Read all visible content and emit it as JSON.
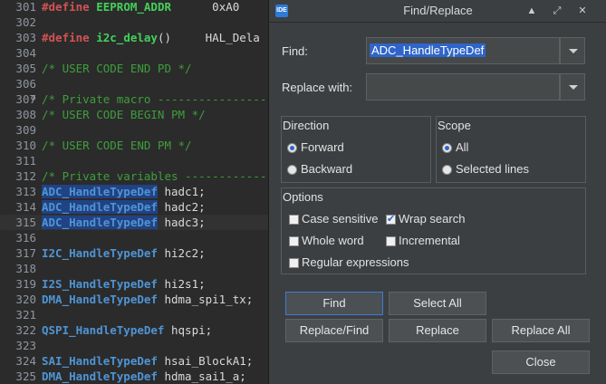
{
  "editor": {
    "lines": [
      {
        "num": "301",
        "parts": [
          {
            "c": "pp",
            "t": "#define "
          },
          {
            "c": "mac",
            "t": "EEPROM_ADDR"
          },
          {
            "c": "kw",
            "t": "      0xA0"
          }
        ]
      },
      {
        "num": "302",
        "parts": []
      },
      {
        "num": "303",
        "parts": [
          {
            "c": "pp",
            "t": "#define "
          },
          {
            "c": "mac",
            "t": "i2c_delay"
          },
          {
            "c": "kw",
            "t": "()     HAL_Dela"
          }
        ]
      },
      {
        "num": "304",
        "parts": []
      },
      {
        "num": "305",
        "parts": [
          {
            "c": "cm",
            "t": "/* USER CODE END PD */"
          }
        ]
      },
      {
        "num": "306",
        "parts": []
      },
      {
        "num": "307",
        "fold": "⊖",
        "parts": [
          {
            "c": "cm",
            "t": "/* Private macro -----------------"
          }
        ]
      },
      {
        "num": "308",
        "parts": [
          {
            "c": "cm",
            "t": "/* USER CODE BEGIN PM */"
          }
        ]
      },
      {
        "num": "309",
        "parts": []
      },
      {
        "num": "310",
        "parts": [
          {
            "c": "cm",
            "t": "/* USER CODE END PM */"
          }
        ]
      },
      {
        "num": "311",
        "parts": []
      },
      {
        "num": "312",
        "parts": [
          {
            "c": "cm",
            "t": "/* Private variables -------------"
          }
        ]
      },
      {
        "num": "313",
        "parts": [
          {
            "c": "ty hl",
            "t": "ADC_HandleTypeDef"
          },
          {
            "c": "kw",
            "t": " hadc1;"
          }
        ]
      },
      {
        "num": "314",
        "parts": [
          {
            "c": "ty hl",
            "t": "ADC_HandleTypeDef"
          },
          {
            "c": "kw",
            "t": " hadc2;"
          }
        ]
      },
      {
        "num": "315",
        "cur": true,
        "parts": [
          {
            "c": "ty hl",
            "t": "ADC_HandleTypeDef"
          },
          {
            "c": "kw",
            "t": " hadc3;"
          }
        ]
      },
      {
        "num": "316",
        "parts": []
      },
      {
        "num": "317",
        "parts": [
          {
            "c": "ty",
            "t": "I2C_HandleTypeDef"
          },
          {
            "c": "kw",
            "t": " hi2c2;"
          }
        ]
      },
      {
        "num": "318",
        "parts": []
      },
      {
        "num": "319",
        "parts": [
          {
            "c": "ty",
            "t": "I2S_HandleTypeDef"
          },
          {
            "c": "kw",
            "t": " hi2s1;"
          }
        ]
      },
      {
        "num": "320",
        "parts": [
          {
            "c": "ty",
            "t": "DMA_HandleTypeDef"
          },
          {
            "c": "kw",
            "t": " hdma_spi1_tx;"
          }
        ]
      },
      {
        "num": "321",
        "parts": []
      },
      {
        "num": "322",
        "parts": [
          {
            "c": "ty",
            "t": "QSPI_HandleTypeDef"
          },
          {
            "c": "kw",
            "t": " hqspi;"
          }
        ]
      },
      {
        "num": "323",
        "parts": []
      },
      {
        "num": "324",
        "parts": [
          {
            "c": "ty",
            "t": "SAI_HandleTypeDef"
          },
          {
            "c": "kw",
            "t": " hsai_BlockA1;"
          }
        ]
      },
      {
        "num": "325",
        "parts": [
          {
            "c": "ty",
            "t": "DMA_HandleTypeDef"
          },
          {
            "c": "kw",
            "t": " hdma_sai1_a;"
          }
        ]
      }
    ]
  },
  "dialog": {
    "icon_text": "IDE",
    "title": "Find/Replace",
    "find_label": "Find:",
    "find_value": "ADC_HandleTypeDef",
    "replace_label": "Replace with:",
    "replace_value": "",
    "direction": {
      "title": "Direction",
      "forward": "Forward",
      "backward": "Backward",
      "selected": "forward"
    },
    "scope": {
      "title": "Scope",
      "all": "All",
      "selected_lines": "Selected lines",
      "selected": "all"
    },
    "options": {
      "title": "Options",
      "case_sensitive": {
        "label": "Case sensitive",
        "checked": false
      },
      "wrap_search": {
        "label": "Wrap search",
        "checked": true
      },
      "whole_word": {
        "label": "Whole word",
        "checked": false
      },
      "incremental": {
        "label": "Incremental",
        "checked": false
      },
      "regex": {
        "label": "Regular expressions",
        "checked": false
      }
    },
    "buttons": {
      "find": "Find",
      "select_all": "Select All",
      "replace_find": "Replace/Find",
      "replace": "Replace",
      "replace_all": "Replace All",
      "close": "Close"
    },
    "icons": [
      "app-icon",
      "minimize-icon",
      "restore-icon",
      "close-icon",
      "dropdown-arrow-icon"
    ]
  }
}
